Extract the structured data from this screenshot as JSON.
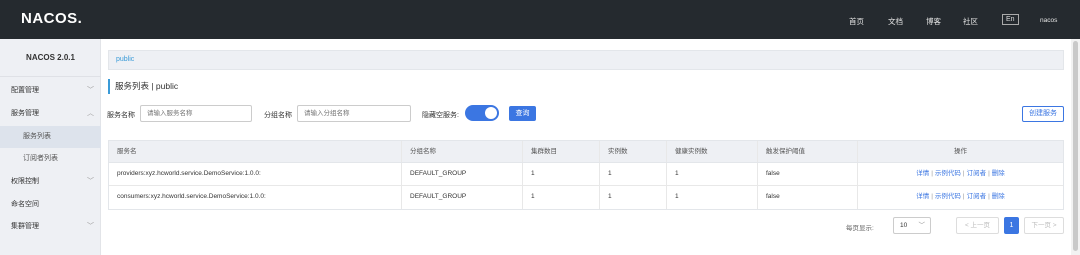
{
  "topbar": {
    "logo": "NACOS.",
    "nav": [
      "首页",
      "文档",
      "博客",
      "社区"
    ],
    "lang": "En",
    "user": "nacos"
  },
  "sidebar": {
    "title": "NACOS 2.0.1",
    "items": [
      {
        "label": "配置管理",
        "chevron": "﹀"
      },
      {
        "label": "服务管理",
        "chevron": "︿"
      },
      {
        "label": "服务列表"
      },
      {
        "label": "订阅者列表"
      },
      {
        "label": "权限控制",
        "chevron": "﹀"
      },
      {
        "label": "命名空间"
      },
      {
        "label": "集群管理",
        "chevron": "﹀"
      }
    ]
  },
  "namespace": "public",
  "page_title": "服务列表 | public",
  "filters": {
    "service_name_label": "服务名称",
    "service_name_placeholder": "请输入服务名称",
    "group_name_label": "分组名称",
    "group_name_placeholder": "请输入分组名称",
    "hide_empty_label": "隐藏空服务:",
    "query_button": "查询",
    "create_button": "创建服务"
  },
  "table": {
    "columns": [
      "服务名",
      "分组名称",
      "集群数目",
      "实例数",
      "健康实例数",
      "触发保护阈值",
      "操作"
    ],
    "rows": [
      [
        "providers:xyz.hcworld.service.DemoService:1.0.0:",
        "DEFAULT_GROUP",
        "1",
        "1",
        "1",
        "false"
      ],
      [
        "consumers:xyz.hcworld.service.DemoService:1.0.0:",
        "DEFAULT_GROUP",
        "1",
        "1",
        "1",
        "false"
      ]
    ],
    "ops": [
      "详情",
      "示例代码",
      "订阅者",
      "删除"
    ]
  },
  "pagination": {
    "page_size_label": "每页显示:",
    "page_size": "10",
    "prev": "< 上一页",
    "current": "1",
    "next": "下一页 >"
  },
  "colors": {
    "accent": "#3b76e2",
    "topbar": "#252a2f",
    "link": "#3a9bd8"
  }
}
